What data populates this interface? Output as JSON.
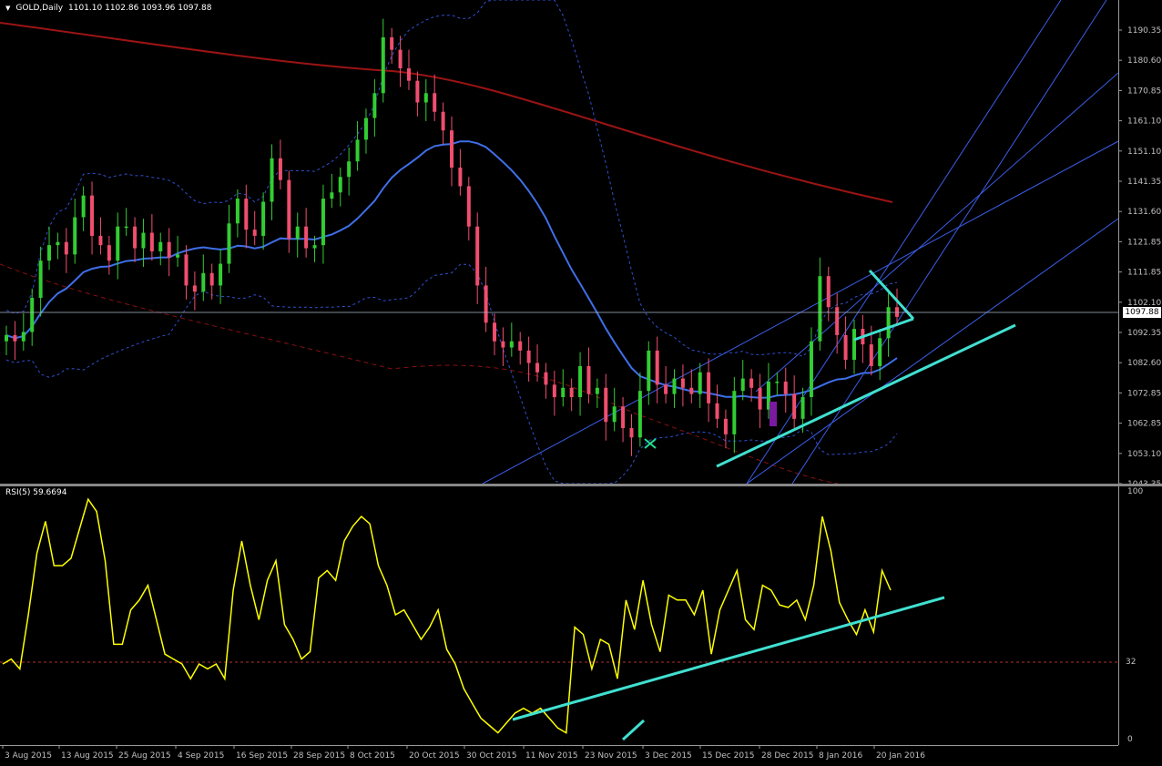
{
  "header": {
    "symbol_label": "GOLD,Daily",
    "ohlc_text": "1101.10 1102.86 1093.96 1097.88"
  },
  "price_axis": {
    "ticks": [
      "1190.35",
      "1180.60",
      "1170.85",
      "1161.10",
      "1151.10",
      "1141.35",
      "1131.60",
      "1121.85",
      "1111.85",
      "1102.10",
      "1092.35",
      "1082.60",
      "1072.85",
      "1062.85",
      "1053.10",
      "1043.35"
    ],
    "current_price_label": "1097.88"
  },
  "rsi": {
    "label": "RSI(5) 59.6694",
    "levels": [
      "100",
      "32",
      "0"
    ]
  },
  "time_axis": {
    "ticks": [
      "3 Aug 2015",
      "13 Aug 2015",
      "25 Aug 2015",
      "4 Sep 2015",
      "16 Sep 2015",
      "28 Sep 2015",
      "8 Oct 2015",
      "20 Oct 2015",
      "30 Oct 2015",
      "11 Nov 2015",
      "23 Nov 2015",
      "3 Dec 2015",
      "15 Dec 2015",
      "28 Dec 2015",
      "8 Jan 2016",
      "20 Jan 2016"
    ]
  },
  "colors": {
    "background": "#000000",
    "bull_candle": "#32cd32",
    "bear_candle": "#f04e6e",
    "ma_fast": "#3f6fe8",
    "ma_slow": "#9b1414",
    "bollinger": "#3050d0",
    "rsi_line": "#ffff00",
    "trend_line": "#40e0d0",
    "channel_line": "#3a5ee8",
    "axis_text": "#c0c0c0"
  },
  "chart_data": [
    {
      "type": "candlestick",
      "symbol": "GOLD",
      "timeframe": "Daily",
      "last_bar": {
        "open": 1101.1,
        "high": 1102.86,
        "low": 1093.96,
        "close": 1097.88
      },
      "ylim": [
        1043.35,
        1195
      ],
      "x_ticks": [
        "3 Aug 2015",
        "13 Aug 2015",
        "25 Aug 2015",
        "4 Sep 2015",
        "16 Sep 2015",
        "28 Sep 2015",
        "8 Oct 2015",
        "20 Oct 2015",
        "30 Oct 2015",
        "11 Nov 2015",
        "23 Nov 2015",
        "3 Dec 2015",
        "15 Dec 2015",
        "28 Dec 2015",
        "8 Jan 2016",
        "20 Jan 2016"
      ],
      "close_series": [
        1092,
        1090,
        1093,
        1104,
        1116,
        1121,
        1122,
        1118,
        1130,
        1137,
        1124,
        1121,
        1116,
        1127,
        1127,
        1120,
        1125,
        1119,
        1122,
        1117,
        1118,
        1108,
        1106,
        1112,
        1108,
        1115,
        1128,
        1136,
        1126,
        1124,
        1135,
        1149,
        1142,
        1123,
        1127,
        1120,
        1121,
        1136,
        1138,
        1143,
        1148,
        1155,
        1162,
        1170,
        1188,
        1184,
        1178,
        1174,
        1167,
        1170,
        1164,
        1158,
        1146,
        1140,
        1127,
        1108,
        1096,
        1090,
        1088,
        1090,
        1087,
        1083,
        1080,
        1076,
        1072,
        1075,
        1072,
        1082,
        1073,
        1075,
        1064,
        1069,
        1062,
        1059,
        1074,
        1087,
        1076,
        1073,
        1078,
        1075,
        1073,
        1080,
        1070,
        1065,
        1060,
        1074,
        1078,
        1075,
        1068,
        1077,
        1077,
        1073,
        1065,
        1072,
        1090,
        1111,
        1101,
        1092,
        1084,
        1094,
        1089,
        1082,
        1091,
        1101,
        1097.88
      ]
    },
    {
      "type": "line",
      "title": "RSI(5) 59.6694",
      "ylim": [
        0,
        100
      ],
      "levels": [
        32
      ],
      "y_ticks": [
        "100",
        "32",
        "0"
      ],
      "values": [
        30,
        32,
        28,
        50,
        75,
        88,
        70,
        70,
        73,
        85,
        97,
        92,
        72,
        38,
        38,
        52,
        56,
        62,
        48,
        34,
        32,
        30,
        24,
        30,
        28,
        30,
        24,
        60,
        80,
        62,
        48,
        64,
        72,
        46,
        40,
        32,
        35,
        65,
        68,
        64,
        80,
        86,
        90,
        87,
        70,
        62,
        50,
        52,
        46,
        40,
        45,
        52,
        36,
        30,
        20,
        14,
        8,
        5,
        2,
        6,
        10,
        12,
        10,
        12,
        8,
        4,
        2,
        45,
        42,
        28,
        40,
        38,
        24,
        56,
        44,
        64,
        46,
        35,
        58,
        56,
        56,
        50,
        60,
        34,
        52,
        60,
        68,
        48,
        44,
        62,
        60,
        54,
        53,
        56,
        48,
        62,
        90,
        76,
        55,
        48,
        42,
        52,
        43,
        68,
        60
      ]
    }
  ]
}
